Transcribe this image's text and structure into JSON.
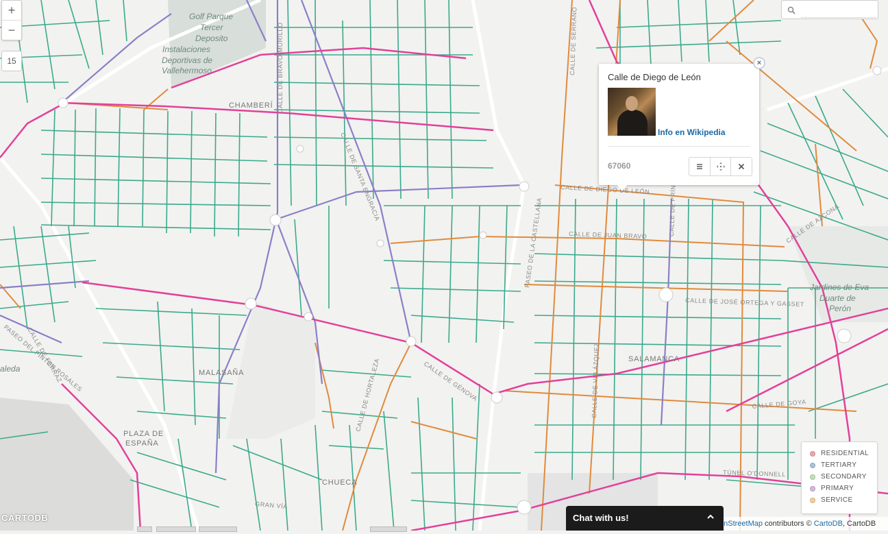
{
  "map": {
    "zoom_in": "+",
    "zoom_out": "−",
    "zoom_level": "15",
    "labels": [
      "CHAMBERÍ",
      "MALASAÑA",
      "CHUECA",
      "SALAMANCA",
      "PLAZA DE",
      "ESPAÑA",
      "Golf Parque",
      "Tercer",
      "Deposito",
      "Instalaciones",
      "Deportivas de",
      "Vallehermoso",
      "Jardines de Eva",
      "Duarte de",
      "Perón",
      "aleda"
    ],
    "street_labels": [
      "CALLE DE BRAVO MURILLO",
      "CALLE DE SANTA ENGRACIA",
      "CALLE DE SERRANO",
      "CALLE DE DIEGO DE LEÓN",
      "CALLE DE JUAN BRAVO",
      "CALLE DE JOSÉ ORTEGA Y GASSET",
      "PASEO DE LA CASTELLANA",
      "CALLE DE VELÁZQUEZ",
      "CALLE DE GOYA",
      "CALLE DE HORTALEZA",
      "GRAN VÍA",
      "PASEO DEL PINTOR ROSALES",
      "CALLE DE FERRAZ",
      "TÚNEL O'DONNELL",
      "CALLE DE AZCONA",
      "CALLE DE GÉNOVA",
      "CALLE DE PRÍNCIPE DE VERGARA"
    ]
  },
  "search": {
    "placeholder": ""
  },
  "popup": {
    "title": "Calle de Diego de León",
    "link": "Info en Wikipedia",
    "id": "67060",
    "close": "×"
  },
  "legend": {
    "items": [
      {
        "label": "RESIDENTIAL",
        "color": "#f0a5a8"
      },
      {
        "label": "TERTIARY",
        "color": "#a9c3dc"
      },
      {
        "label": "SECONDARY",
        "color": "#bfe3b4"
      },
      {
        "label": "PRIMARY",
        "color": "#d6b6e0"
      },
      {
        "label": "SERVICE",
        "color": "#f6cf92"
      }
    ]
  },
  "chat": {
    "label": "Chat with us!"
  },
  "attribution": {
    "osm": "enStreetMap",
    "contrib": " contributors © ",
    "cartodb": "CartoDB",
    "tail": ", CartoDB"
  },
  "logo": "CARTODB",
  "colors": {
    "residential": "#3aa98c",
    "service": "#e08a3c",
    "primary": "#e2409a",
    "tertiary": "#8a7fc8",
    "background": "#f2f2f0"
  }
}
